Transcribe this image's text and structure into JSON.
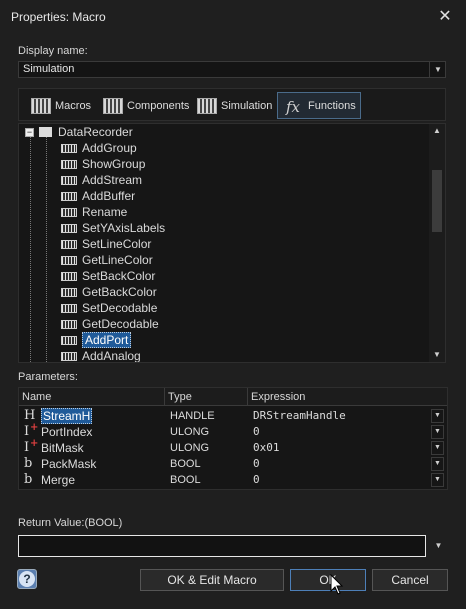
{
  "window": {
    "title": "Properties: Macro",
    "close_icon": "close-icon"
  },
  "display_name": {
    "label": "Display name:",
    "value": "Simulation"
  },
  "tabs": [
    {
      "label": "Macros",
      "icon": "macro-icon",
      "active": false
    },
    {
      "label": "Components",
      "icon": "components-icon",
      "active": false
    },
    {
      "label": "Simulation",
      "icon": "simulation-icon",
      "active": false
    },
    {
      "label": "Functions",
      "icon": "fx-icon",
      "active": true
    }
  ],
  "tree": {
    "root": "DataRecorder",
    "items": [
      "AddGroup",
      "ShowGroup",
      "AddStream",
      "AddBuffer",
      "Rename",
      "SetYAxisLabels",
      "SetLineColor",
      "GetLineColor",
      "SetBackColor",
      "GetBackColor",
      "SetDecodable",
      "GetDecodable",
      "AddPort",
      "AddAnalog"
    ],
    "selected": "AddPort"
  },
  "parameters": {
    "label": "Parameters:",
    "columns": [
      "Name",
      "Type",
      "Expression"
    ],
    "rows": [
      {
        "name": "StreamH",
        "type": "HANDLE",
        "expr": "DRStreamHandle",
        "icon": "handle-icon",
        "selected": true
      },
      {
        "name": "PortIndex",
        "type": "ULONG",
        "expr": "0",
        "icon": "integer-icon",
        "selected": false
      },
      {
        "name": "BitMask",
        "type": "ULONG",
        "expr": "0x01",
        "icon": "integer-icon",
        "selected": false
      },
      {
        "name": "PackMask",
        "type": "BOOL",
        "expr": "0",
        "icon": "bool-icon",
        "selected": false
      },
      {
        "name": "Merge",
        "type": "BOOL",
        "expr": "0",
        "icon": "bool-icon",
        "selected": false
      }
    ]
  },
  "return_value": {
    "label": "Return Value:(BOOL)",
    "value": ""
  },
  "buttons": {
    "edit": "OK & Edit Macro",
    "ok": "OK",
    "cancel": "Cancel"
  },
  "colors": {
    "selection": "#1f5a99",
    "background": "#1f1f1f",
    "accent": "#4d7fb8"
  }
}
